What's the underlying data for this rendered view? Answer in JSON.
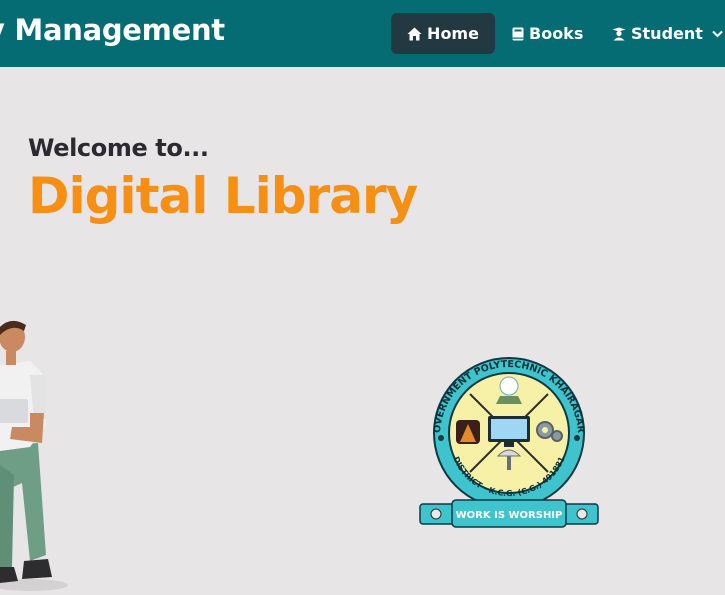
{
  "navbar": {
    "brand": "ry Management",
    "items": [
      {
        "label": "Home",
        "icon": "home-icon",
        "active": true
      },
      {
        "label": "Books",
        "icon": "book-icon"
      },
      {
        "label": "Student",
        "icon": "student-icon",
        "has_dropdown": true
      }
    ]
  },
  "hero": {
    "welcome": "Welcome to...",
    "title": "Digital Library"
  },
  "logo": {
    "ring_text": "GOVERNMENT POLYTECHNIC KHAIRAGARH",
    "bottom_text": "DISTRICT - K.C.G. (C.G.) 491881",
    "banner": "WORK IS WORSHIP"
  },
  "colors": {
    "navbar_bg": "#066c74",
    "active_nav_bg": "#223941",
    "accent_orange": "#f68f14",
    "page_bg": "#e8e5e7"
  }
}
